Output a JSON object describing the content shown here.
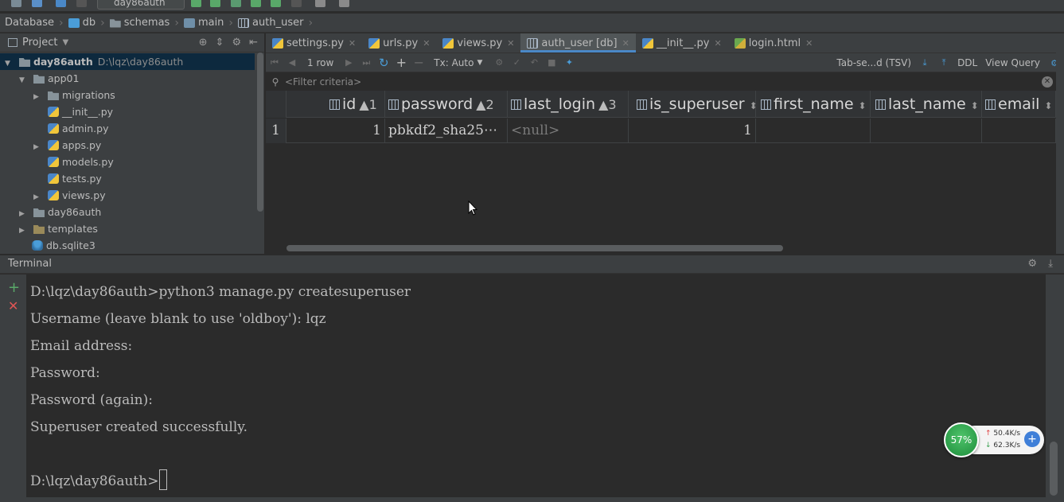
{
  "toolbar": {
    "run_config": "day86auth"
  },
  "breadcrumb": {
    "items": [
      {
        "label": "Database",
        "icon": "database-icon"
      },
      {
        "label": "db",
        "icon": "datasource-icon"
      },
      {
        "label": "schemas",
        "icon": "folder-icon"
      },
      {
        "label": "main",
        "icon": "schema-icon"
      },
      {
        "label": "auth_user",
        "icon": "table-icon"
      }
    ]
  },
  "project": {
    "title": "Project",
    "tree": [
      {
        "label": "day86auth",
        "path": "D:\\lqz\\day86auth",
        "depth": 0,
        "expanded": true,
        "kind": "folder"
      },
      {
        "label": "app01",
        "depth": 1,
        "expanded": true,
        "kind": "folder"
      },
      {
        "label": "migrations",
        "depth": 2,
        "expanded": false,
        "kind": "folder"
      },
      {
        "label": "__init__.py",
        "depth": 2,
        "kind": "py"
      },
      {
        "label": "admin.py",
        "depth": 2,
        "kind": "py"
      },
      {
        "label": "apps.py",
        "depth": 2,
        "expanded": false,
        "kind": "py"
      },
      {
        "label": "models.py",
        "depth": 2,
        "kind": "py"
      },
      {
        "label": "tests.py",
        "depth": 2,
        "kind": "py"
      },
      {
        "label": "views.py",
        "depth": 2,
        "expanded": false,
        "kind": "py"
      },
      {
        "label": "day86auth",
        "depth": 1,
        "expanded": false,
        "kind": "folder"
      },
      {
        "label": "templates",
        "depth": 1,
        "expanded": false,
        "kind": "folder"
      },
      {
        "label": "db.sqlite3",
        "depth": 1,
        "kind": "db"
      }
    ]
  },
  "tabs": [
    {
      "label": "settings.py",
      "icon": "python-file-icon",
      "active": false
    },
    {
      "label": "urls.py",
      "icon": "python-file-icon",
      "active": false
    },
    {
      "label": "views.py",
      "icon": "python-file-icon",
      "active": false
    },
    {
      "label": "auth_user [db]",
      "icon": "table-icon",
      "active": true
    },
    {
      "label": "__init__.py",
      "icon": "python-file-icon",
      "active": false
    },
    {
      "label": "login.html",
      "icon": "html-file-icon",
      "active": false
    }
  ],
  "gridbar": {
    "row_count": "1 row",
    "tx_mode": "Tx: Auto",
    "format": "Tab-se...d (TSV)",
    "ddl": "DDL",
    "view_query": "View Query"
  },
  "filter": {
    "placeholder": "<Filter criteria>"
  },
  "grid": {
    "columns": [
      {
        "name": "id",
        "sort": "▲1"
      },
      {
        "name": "password",
        "sort": "▲2"
      },
      {
        "name": "last_login",
        "sort": "▲3"
      },
      {
        "name": "is_superuser",
        "sort": ""
      },
      {
        "name": "first_name",
        "sort": ""
      },
      {
        "name": "last_name",
        "sort": ""
      },
      {
        "name": "email",
        "sort": ""
      }
    ],
    "rows": [
      {
        "rownum": "1",
        "id": "1",
        "password": "pbkdf2_sha25⋯",
        "last_login": "<null>",
        "is_superuser": "1",
        "first_name": "",
        "last_name": "",
        "email": ""
      }
    ]
  },
  "terminal": {
    "title": "Terminal",
    "lines": [
      "D:\\lqz\\day86auth>python3 manage.py createsuperuser",
      "Username (leave blank to use 'oldboy'): lqz",
      "Email address:",
      "Password:",
      "Password (again):",
      "Superuser created successfully.",
      "",
      "D:\\lqz\\day86auth>"
    ]
  },
  "netmon": {
    "percent": "57%",
    "upload": "50.4K/s",
    "download": "62.3K/s"
  }
}
